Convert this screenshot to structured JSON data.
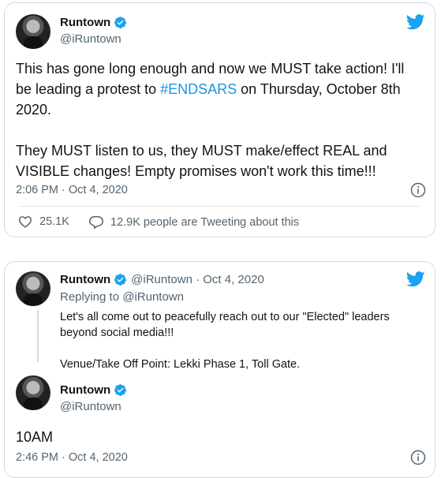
{
  "tweet1": {
    "name": "Runtown",
    "handle": "@iRuntown",
    "text_line1": "This has gone long enough and now we MUST take action! I'll",
    "text_line2_pre": "be leading a protest to ",
    "hashtag": "#ENDSARS",
    "text_line2_post": " on Thursday, October 8th",
    "text_line3": "2020.",
    "text_line4": "They MUST listen to us, they MUST make/effect REAL and",
    "text_line5": "VISIBLE changes! Empty promises won't work this time!!!",
    "timestamp": "2:06 PM · Oct 4, 2020",
    "likes": "25.1K",
    "retweet_text": "12.9K people are Tweeting about this"
  },
  "tweet2": {
    "name": "Runtown",
    "handle_date": "@iRuntown · Oct 4, 2020",
    "replying_to": "Replying to @iRuntown",
    "line1": "Let's all come out to peacefully reach out to our \"Elected\" leaders",
    "line2": "beyond social media!!!",
    "line3": "Venue/Take Off Point: Lekki Phase 1, Toll Gate."
  },
  "tweet3": {
    "name": "Runtown",
    "handle": "@iRuntown",
    "text": "10AM",
    "timestamp": "2:46 PM · Oct 4, 2020"
  },
  "colors": {
    "twitter_blue": "#1da1f2",
    "hashtag": "#1b95e0",
    "muted": "#536471",
    "border": "#cfd9de"
  },
  "icons": [
    "twitter-bird-icon",
    "verified-badge-icon",
    "info-icon",
    "heart-icon",
    "reply-bubble-icon"
  ]
}
